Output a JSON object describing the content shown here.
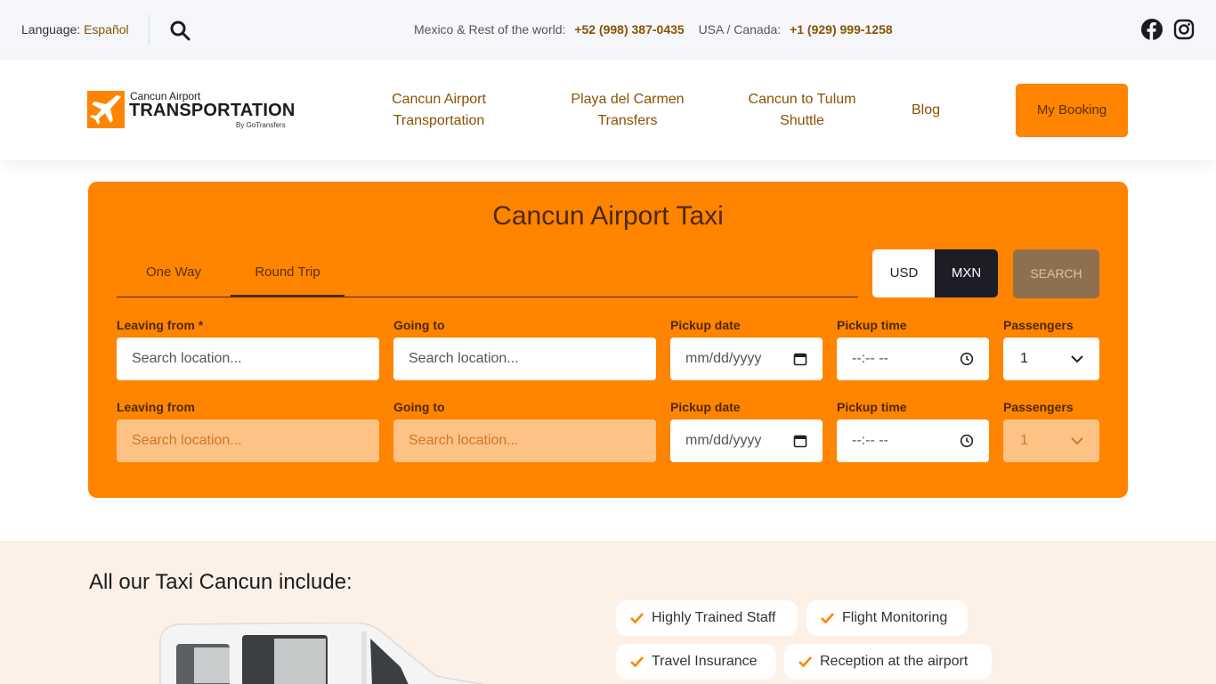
{
  "topbar": {
    "language_label": "Language:",
    "language_link": "Español",
    "mexico_label": "Mexico & Rest of the world:",
    "mexico_phone": "+52 (998) 387-0435",
    "usa_label": "USA / Canada:",
    "usa_phone": "+1 (929) 999-1258"
  },
  "header": {
    "logo_small": "Cancun Airport",
    "logo_big": "TRANSPORTATION",
    "logo_by": "By GoTransfers",
    "nav": [
      {
        "line1": "Cancun Airport",
        "line2": "Transportation"
      },
      {
        "line1": "Playa del Carmen",
        "line2": "Transfers"
      },
      {
        "line1": "Cancun to Tulum",
        "line2": "Shuttle"
      },
      {
        "line1": "Blog"
      }
    ],
    "my_booking": "My Booking"
  },
  "booking": {
    "title": "Cancun Airport Taxi",
    "tabs": [
      "One Way",
      "Round Trip"
    ],
    "active_tab": "Round Trip",
    "currencies": [
      "USD",
      "MXN"
    ],
    "active_currency": "MXN",
    "search": "SEARCH",
    "row1": {
      "leaving_label": "Leaving from *",
      "leaving_placeholder": "Search location...",
      "going_label": "Going to",
      "going_placeholder": "Search location...",
      "date_label": "Pickup date",
      "date_value": "mm/dd/yyyy",
      "time_label": "Pickup time",
      "time_value": "--:-- --",
      "pax_label": "Passengers",
      "pax_value": "1"
    },
    "row2": {
      "leaving_label": "Leaving from",
      "leaving_placeholder": "Search location...",
      "going_label": "Going to",
      "going_placeholder": "Search location...",
      "date_label": "Pickup date",
      "date_value": "mm/dd/yyyy",
      "time_label": "Pickup time",
      "time_value": "--:-- --",
      "pax_label": "Passengers",
      "pax_value": "1"
    }
  },
  "features": {
    "title": "All our Taxi Cancun include:",
    "chips": [
      "Highly Trained Staff",
      "Flight Monitoring",
      "Travel Insurance",
      "Reception at the airport"
    ]
  },
  "colors": {
    "brand_orange": "#ff8400",
    "brand_brown": "#8a5200",
    "dark": "#1d1d27"
  },
  "icons": [
    "search-icon",
    "facebook-icon",
    "instagram-icon",
    "airplane-logo-icon",
    "calendar-icon",
    "clock-icon",
    "chevron-down-icon",
    "check-icon"
  ]
}
